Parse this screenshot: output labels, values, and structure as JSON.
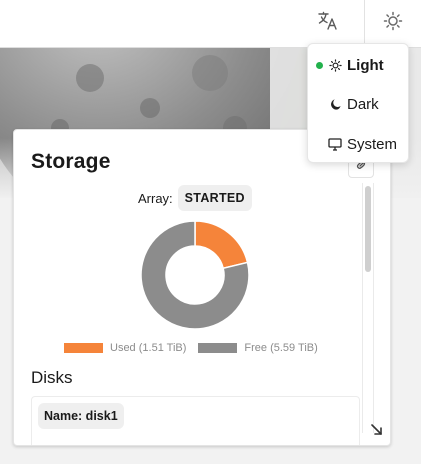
{
  "theme_menu": {
    "items": [
      {
        "label": "Light",
        "icon": "sun-icon",
        "selected": true
      },
      {
        "label": "Dark",
        "icon": "moon-icon",
        "selected": false
      },
      {
        "label": "System",
        "icon": "monitor-icon",
        "selected": false
      }
    ],
    "selected_color": "#22b14c"
  },
  "storage": {
    "title": "Storage",
    "array_label": "Array:",
    "array_status": "STARTED",
    "legend": {
      "used": "Used (1.51 TiB)",
      "free": "Free (5.59 TiB)"
    },
    "disks_title": "Disks",
    "disk_name": "Name: disk1"
  },
  "colors": {
    "used": "#f5843a",
    "free": "#8c8c8c"
  },
  "chart_data": {
    "type": "pie",
    "categories": [
      "Used (1.51 TiB)",
      "Free (5.59 TiB)"
    ],
    "values": [
      1.51,
      5.59
    ]
  }
}
